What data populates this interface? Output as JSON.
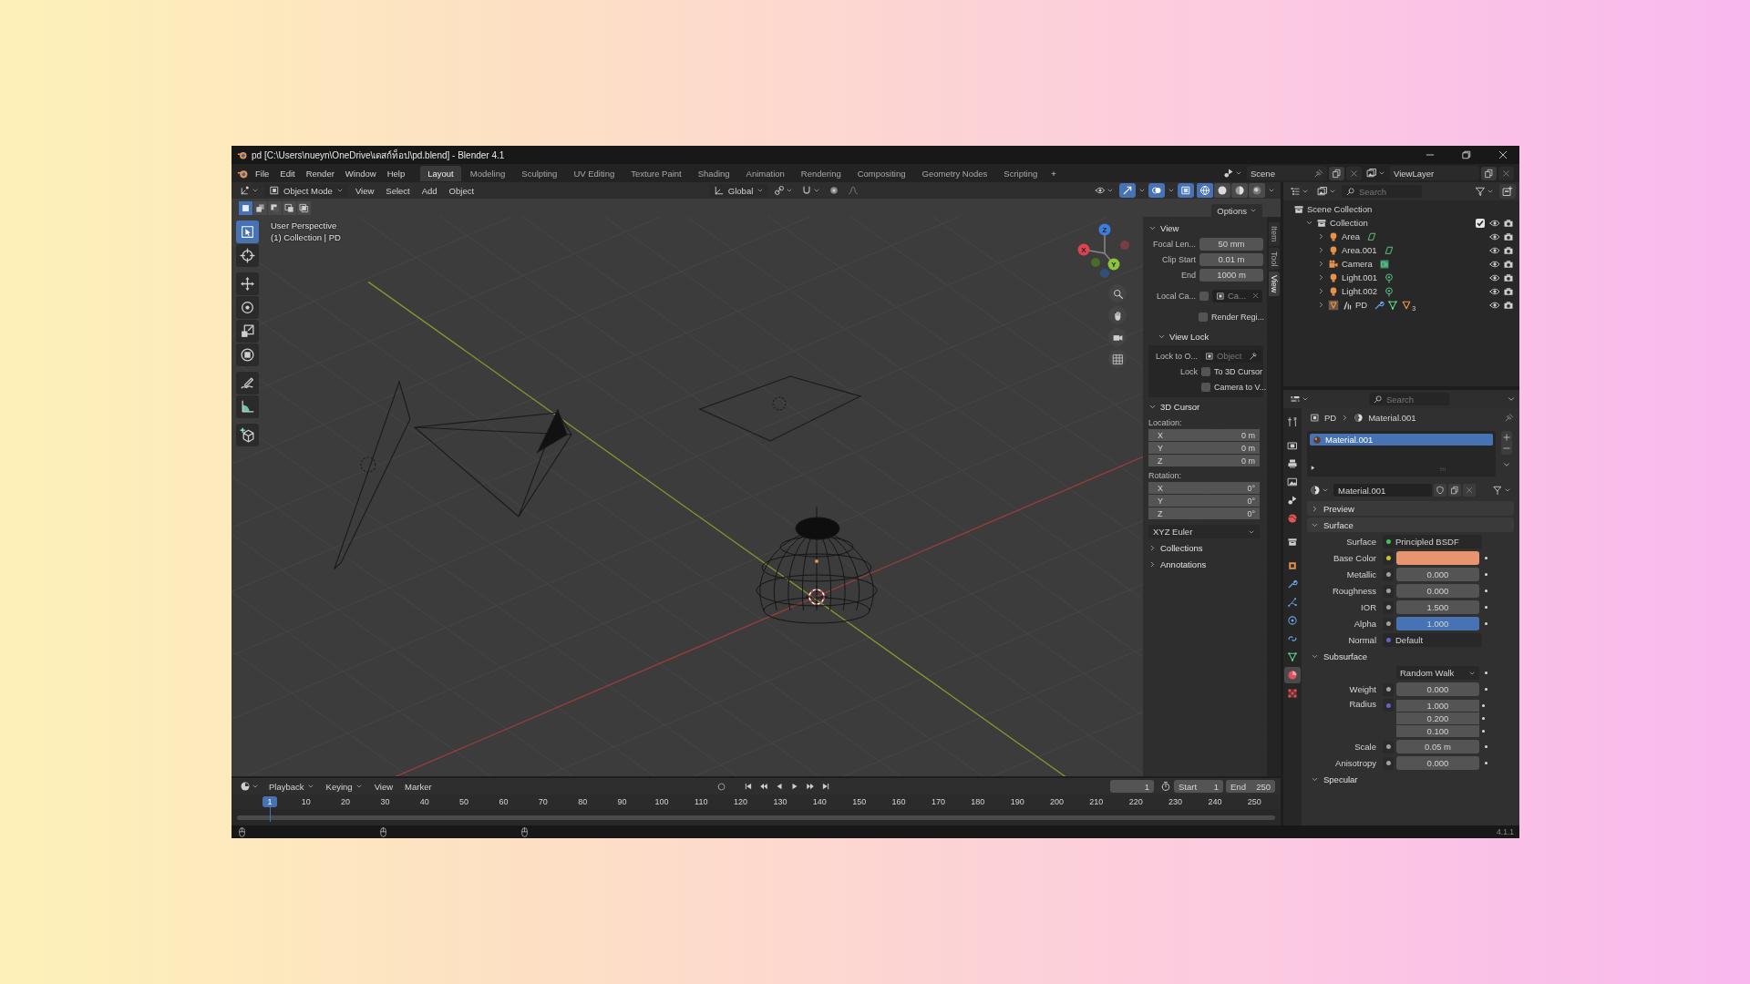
{
  "window": {
    "title": "pd [C:\\Users\\nueyn\\OneDrive\\เดสก์ท็อป\\pd.blend] - Blender 4.1"
  },
  "menu": [
    "File",
    "Edit",
    "Render",
    "Window",
    "Help"
  ],
  "workspaces": [
    {
      "label": "Layout",
      "selected": true
    },
    {
      "label": "Modeling",
      "selected": false
    },
    {
      "label": "Sculpting",
      "selected": false
    },
    {
      "label": "UV Editing",
      "selected": false
    },
    {
      "label": "Texture Paint",
      "selected": false
    },
    {
      "label": "Shading",
      "selected": false
    },
    {
      "label": "Animation",
      "selected": false
    },
    {
      "label": "Rendering",
      "selected": false
    },
    {
      "label": "Compositing",
      "selected": false
    },
    {
      "label": "Geometry Nodes",
      "selected": false
    },
    {
      "label": "Scripting",
      "selected": false
    }
  ],
  "add_workspace": "+",
  "scene": {
    "name": "Scene"
  },
  "view_layer": {
    "name": "ViewLayer"
  },
  "viewport": {
    "mode": "Object Mode",
    "menus": [
      "View",
      "Select",
      "Add",
      "Object"
    ],
    "orientation": "Global",
    "options": "Options",
    "select_modes": [
      {
        "kind": "set",
        "selected": true
      },
      {
        "kind": "extend",
        "selected": false
      },
      {
        "kind": "subtract",
        "selected": false
      },
      {
        "kind": "invert",
        "selected": false
      },
      {
        "kind": "intersect",
        "selected": false
      }
    ],
    "shading": [
      {
        "kind": "wireframe",
        "selected": true
      },
      {
        "kind": "solid",
        "selected": false
      },
      {
        "kind": "material",
        "selected": false
      },
      {
        "kind": "rendered",
        "selected": false
      }
    ],
    "overlay_text": [
      "User Perspective",
      "(1) Collection | PD"
    ],
    "tools": [
      {
        "kind": "select",
        "selected": true
      },
      {
        "kind": "cursor",
        "selected": false
      },
      {
        "kind": "move",
        "selected": false
      },
      {
        "kind": "rotate",
        "selected": false
      },
      {
        "kind": "scale",
        "selected": false
      },
      {
        "kind": "transform",
        "selected": false
      },
      {
        "kind": "annotate",
        "selected": false
      },
      {
        "kind": "measure",
        "selected": false
      },
      {
        "kind": "add_cube",
        "selected": false
      }
    ],
    "gizmo": [
      "X",
      "Y",
      "Z"
    ]
  },
  "sidebar": {
    "tabs": [
      {
        "label": "Item",
        "selected": false
      },
      {
        "label": "Tool",
        "selected": false
      },
      {
        "label": "View",
        "selected": true
      }
    ],
    "view": {
      "title": "View",
      "expanded": true,
      "fields": [
        {
          "label": "Focal Len...",
          "value": "50 mm"
        },
        {
          "label": "Clip Start",
          "value": "0.01 m"
        },
        {
          "label": "End",
          "value": "1000 m"
        }
      ],
      "local_camera": {
        "label": "Local Ca...",
        "checked": false,
        "placeholder": "Ca..."
      },
      "render_region": {
        "label": "Render Regi...",
        "checked": false
      }
    },
    "view_lock": {
      "title": "View Lock",
      "expanded": true,
      "lock_to": {
        "label": "Lock to O...",
        "placeholder": "Object"
      },
      "lock_label": "Lock",
      "options": [
        {
          "label": "To 3D Cursor",
          "checked": false
        },
        {
          "label": "Camera to V...",
          "checked": false
        }
      ]
    },
    "cursor": {
      "title": "3D Cursor",
      "expanded": true,
      "location_label": "Location:",
      "location": [
        {
          "axis": "X",
          "value": "0 m"
        },
        {
          "axis": "Y",
          "value": "0 m"
        },
        {
          "axis": "Z",
          "value": "0 m"
        }
      ],
      "rotation_label": "Rotation:",
      "rotation": [
        {
          "axis": "X",
          "value": "0°"
        },
        {
          "axis": "Y",
          "value": "0°"
        },
        {
          "axis": "Z",
          "value": "0°"
        }
      ],
      "rotation_mode": "XYZ Euler"
    },
    "collapsed": [
      {
        "title": "Collections",
        "expanded": false
      },
      {
        "title": "Annotations",
        "expanded": false
      }
    ]
  },
  "outliner": {
    "search": {
      "placeholder": "Search"
    },
    "tree": [
      {
        "name": "Scene Collection",
        "kind": "scene_collection",
        "children": [
          {
            "name": "Collection",
            "kind": "collection",
            "expanded": true,
            "checked": true,
            "children": [
              {
                "name": "Area",
                "kind": "area_light",
                "expanded": false
              },
              {
                "name": "Area.001",
                "kind": "area_light",
                "expanded": false
              },
              {
                "name": "Camera",
                "kind": "camera",
                "expanded": false
              },
              {
                "name": "Light.001",
                "kind": "point_light",
                "expanded": false
              },
              {
                "name": "Light.002",
                "kind": "point_light",
                "expanded": false
              },
              {
                "name": "PD",
                "kind": "mesh",
                "expanded": false,
                "count": "3"
              }
            ]
          }
        ]
      }
    ]
  },
  "properties": {
    "search": {
      "placeholder": "Search"
    },
    "tabs": [
      {
        "kind": "tool",
        "selected": false
      },
      {
        "kind": "render",
        "selected": false
      },
      {
        "kind": "output",
        "selected": false
      },
      {
        "kind": "view_layer",
        "selected": false
      },
      {
        "kind": "scene",
        "selected": false
      },
      {
        "kind": "world",
        "selected": false
      },
      {
        "kind": "collection",
        "selected": false
      },
      {
        "kind": "object",
        "selected": false
      },
      {
        "kind": "modifiers",
        "selected": false
      },
      {
        "kind": "particles",
        "selected": false
      },
      {
        "kind": "physics",
        "selected": false
      },
      {
        "kind": "constraints",
        "selected": false
      },
      {
        "kind": "data",
        "selected": false
      },
      {
        "kind": "material",
        "selected": true
      },
      {
        "kind": "texture",
        "selected": false
      }
    ],
    "breadcrumb": [
      "PD",
      "Material.001"
    ],
    "slots": [
      {
        "name": "Material.001",
        "selected": true
      }
    ],
    "material": "Material.001",
    "sections": [
      {
        "title": "Preview",
        "expanded": false
      },
      {
        "title": "Surface",
        "expanded": true,
        "rows": [
          {
            "kind": "link",
            "label": "Surface",
            "value": "Principled BSDF",
            "color": "#3fc35b"
          },
          {
            "kind": "color",
            "label": "Base Color",
            "color": "#e8946e"
          },
          {
            "kind": "number",
            "label": "Metallic",
            "value": "0.000",
            "color": "#a1a1a1"
          },
          {
            "kind": "number",
            "label": "Roughness",
            "value": "0.000",
            "color": "#a1a1a1"
          },
          {
            "kind": "number",
            "label": "IOR",
            "value": "1.500",
            "color": "#a1a1a1"
          },
          {
            "kind": "slider",
            "label": "Alpha",
            "value": "1.000",
            "level": 1,
            "color": "#a1a1a1"
          },
          {
            "kind": "link",
            "label": "Normal",
            "value": "Default",
            "color": "#6363c7"
          }
        ]
      },
      {
        "title": "Subsurface",
        "expanded": true,
        "rows": [
          {
            "kind": "dropdown",
            "value": "Random Walk"
          },
          {
            "kind": "number",
            "label": "Weight",
            "value": "0.000",
            "color": "#a1a1a1"
          },
          {
            "kind": "vector",
            "label": "Radius",
            "values": [
              "1.000",
              "0.200",
              "0.100"
            ],
            "color": "#6363c7"
          },
          {
            "kind": "number",
            "label": "Scale",
            "value": "0.05 m",
            "color": "#a1a1a1"
          },
          {
            "kind": "number",
            "label": "Anisotropy",
            "value": "0.000",
            "color": "#a1a1a1"
          }
        ]
      },
      {
        "title": "Specular",
        "expanded": true
      }
    ]
  },
  "timeline": {
    "menus": [
      {
        "label": "Playback",
        "dropdown": true
      },
      {
        "label": "Keying",
        "dropdown": true
      },
      {
        "label": "View",
        "dropdown": false
      },
      {
        "label": "Marker",
        "dropdown": false
      }
    ],
    "current_frame": "1",
    "start": {
      "label": "Start",
      "value": "1"
    },
    "end": {
      "label": "End",
      "value": "250"
    },
    "ticks": [
      "10",
      "20",
      "30",
      "40",
      "50",
      "60",
      "70",
      "80",
      "90",
      "100",
      "110",
      "120",
      "130",
      "140",
      "150",
      "160",
      "170",
      "180",
      "190",
      "200",
      "210",
      "220",
      "230",
      "240",
      "250"
    ],
    "playhead": "1"
  },
  "version": "4.1.1"
}
